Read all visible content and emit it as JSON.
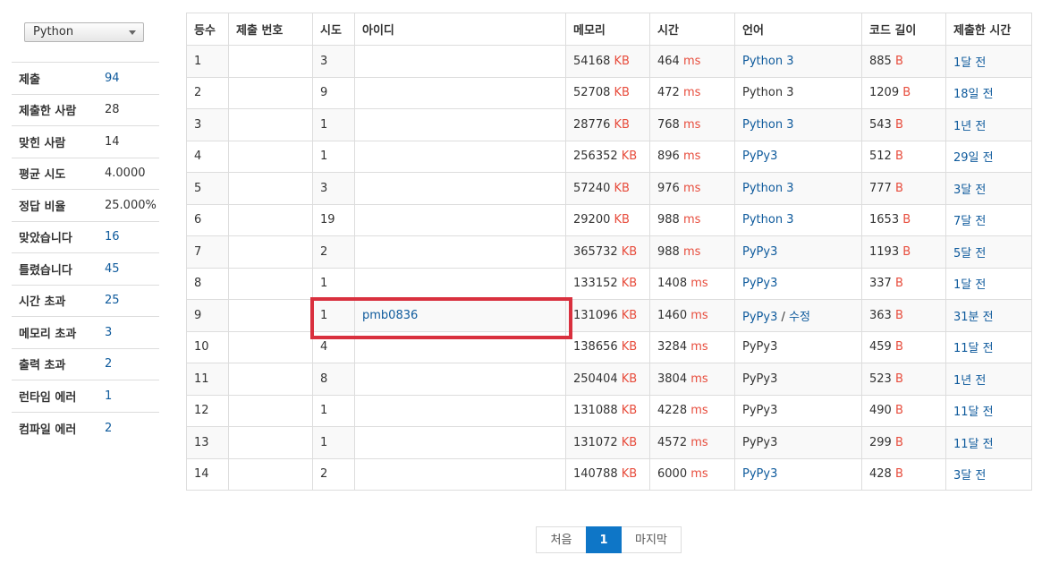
{
  "language_select": {
    "value": "Python"
  },
  "stats": [
    {
      "label": "제출",
      "value": "94",
      "link": true
    },
    {
      "label": "제출한 사람",
      "value": "28",
      "link": false
    },
    {
      "label": "맞힌 사람",
      "value": "14",
      "link": false
    },
    {
      "label": "평균 시도",
      "value": "4.0000",
      "link": false
    },
    {
      "label": "정답 비율",
      "value": "25.000%",
      "link": false
    },
    {
      "label": "맞았습니다",
      "value": "16",
      "link": true
    },
    {
      "label": "틀렸습니다",
      "value": "45",
      "link": true
    },
    {
      "label": "시간 초과",
      "value": "25",
      "link": true
    },
    {
      "label": "메모리 초과",
      "value": "3",
      "link": true
    },
    {
      "label": "출력 초과",
      "value": "2",
      "link": true
    },
    {
      "label": "런타임 에러",
      "value": "1",
      "link": true
    },
    {
      "label": "컴파일 에러",
      "value": "2",
      "link": true
    }
  ],
  "table": {
    "headers": [
      "등수",
      "제출 번호",
      "시도",
      "아이디",
      "메모리",
      "시간",
      "언어",
      "코드 길이",
      "제출한 시간"
    ],
    "units": {
      "memory": "KB",
      "time": "ms",
      "code": "B"
    },
    "edit_label": "수정",
    "rows": [
      {
        "rank": "1",
        "tries": "3",
        "user": "",
        "memory": "54168",
        "time": "464",
        "lang": "Python 3",
        "lang_link": true,
        "code": "885",
        "submitted": "1달 전"
      },
      {
        "rank": "2",
        "tries": "9",
        "user": "",
        "memory": "52708",
        "time": "472",
        "lang": "Python 3",
        "lang_link": false,
        "code": "1209",
        "submitted": "18일 전"
      },
      {
        "rank": "3",
        "tries": "1",
        "user": "",
        "memory": "28776",
        "time": "768",
        "lang": "Python 3",
        "lang_link": true,
        "code": "543",
        "submitted": "1년 전"
      },
      {
        "rank": "4",
        "tries": "1",
        "user": "",
        "memory": "256352",
        "time": "896",
        "lang": "PyPy3",
        "lang_link": true,
        "code": "512",
        "submitted": "29일 전"
      },
      {
        "rank": "5",
        "tries": "3",
        "user": "",
        "memory": "57240",
        "time": "976",
        "lang": "Python 3",
        "lang_link": true,
        "code": "777",
        "submitted": "3달 전"
      },
      {
        "rank": "6",
        "tries": "19",
        "user": "",
        "memory": "29200",
        "time": "988",
        "lang": "Python 3",
        "lang_link": true,
        "code": "1653",
        "submitted": "7달 전"
      },
      {
        "rank": "7",
        "tries": "2",
        "user": "",
        "memory": "365732",
        "time": "988",
        "lang": "PyPy3",
        "lang_link": true,
        "code": "1193",
        "submitted": "5달 전"
      },
      {
        "rank": "8",
        "tries": "1",
        "user": "",
        "memory": "133152",
        "time": "1408",
        "lang": "PyPy3",
        "lang_link": true,
        "code": "337",
        "submitted": "1달 전"
      },
      {
        "rank": "9",
        "tries": "1",
        "user": "pmb0836",
        "memory": "131096",
        "time": "1460",
        "lang": "PyPy3",
        "lang_link": true,
        "edit": true,
        "code": "363",
        "submitted": "31분 전"
      },
      {
        "rank": "10",
        "tries": "4",
        "user": "",
        "memory": "138656",
        "time": "3284",
        "lang": "PyPy3",
        "lang_link": false,
        "code": "459",
        "submitted": "11달 전"
      },
      {
        "rank": "11",
        "tries": "8",
        "user": "",
        "memory": "250404",
        "time": "3804",
        "lang": "PyPy3",
        "lang_link": false,
        "code": "523",
        "submitted": "1년 전"
      },
      {
        "rank": "12",
        "tries": "1",
        "user": "",
        "memory": "131088",
        "time": "4228",
        "lang": "PyPy3",
        "lang_link": false,
        "code": "490",
        "submitted": "11달 전"
      },
      {
        "rank": "13",
        "tries": "1",
        "user": "",
        "memory": "131072",
        "time": "4572",
        "lang": "PyPy3",
        "lang_link": false,
        "code": "299",
        "submitted": "11달 전"
      },
      {
        "rank": "14",
        "tries": "2",
        "user": "",
        "memory": "140788",
        "time": "6000",
        "lang": "PyPy3",
        "lang_link": true,
        "code": "428",
        "submitted": "3달 전"
      }
    ]
  },
  "pagination": {
    "first": "처음",
    "current": "1",
    "last": "마지막"
  },
  "colors": {
    "link": "#0e5a9c",
    "unit": "#e74c3c",
    "highlight": "#d9303e",
    "active_page": "#0e76c7"
  }
}
